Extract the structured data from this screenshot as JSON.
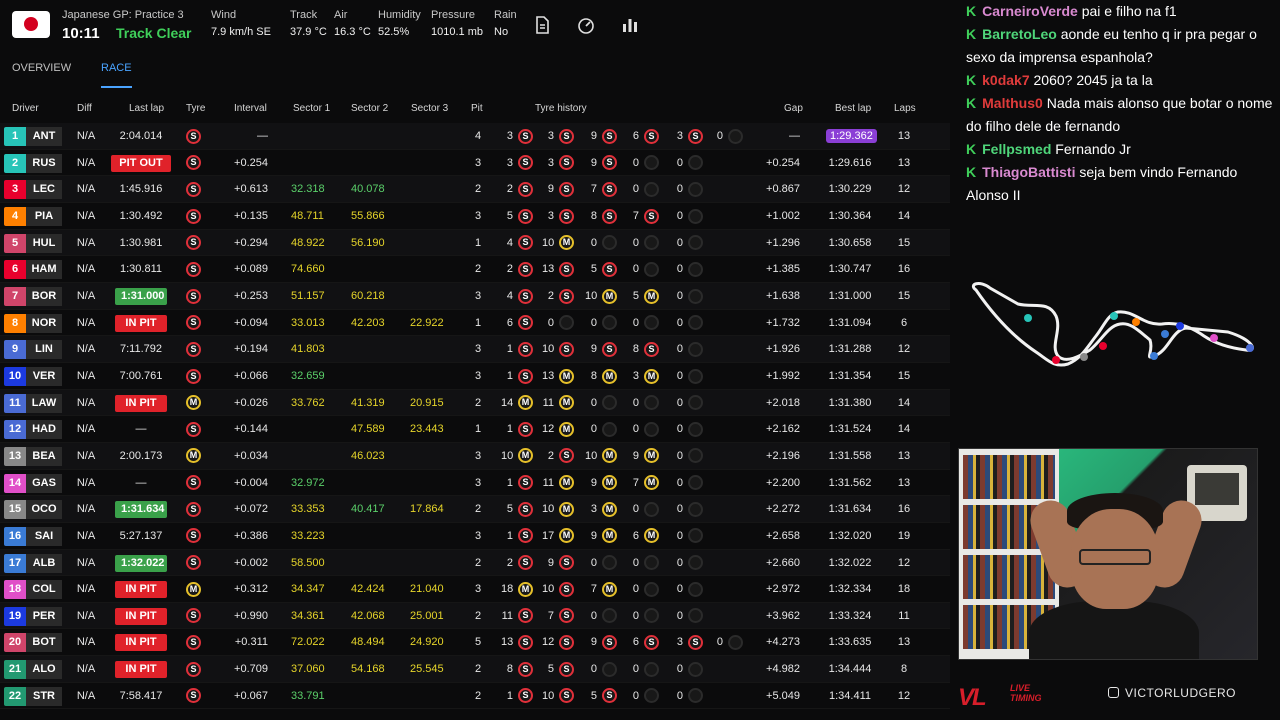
{
  "header": {
    "session": "Japanese GP: Practice 3",
    "clock": "10:11",
    "track_status": "Track Clear",
    "weather": [
      {
        "label": "Wind",
        "value": "7.9 km/h SE"
      },
      {
        "label": "Track",
        "value": "37.9 °C"
      },
      {
        "label": "Air",
        "value": "16.3 °C"
      },
      {
        "label": "Humidity",
        "value": "52.5%"
      },
      {
        "label": "Pressure",
        "value": "1010.1 mb"
      },
      {
        "label": "Rain",
        "value": "No"
      }
    ],
    "icons": [
      "document-icon",
      "gauge-icon",
      "bar-chart-icon"
    ]
  },
  "tabs": [
    "OVERVIEW",
    "RACE"
  ],
  "active_tab": "RACE",
  "columns": [
    "Driver",
    "Diff",
    "Last lap",
    "Tyre",
    "Interval",
    "Sector 1",
    "Sector 2",
    "Sector 3",
    "Pit",
    "Tyre history",
    "Gap",
    "Best lap",
    "Laps"
  ],
  "drivers": [
    {
      "pos": "1",
      "code": "ANT",
      "team_color": "#27c4b8",
      "diff": "N/A",
      "last": "2:04.014",
      "last_style": "",
      "tyre": "S",
      "interval": "—",
      "s1": "",
      "s1c": "",
      "s2": "",
      "s2c": "",
      "s3": "",
      "s3c": "",
      "pit": "4",
      "hist": [
        [
          "3",
          "S"
        ],
        [
          "3",
          "S"
        ],
        [
          "9",
          "S"
        ],
        [
          "6",
          "S"
        ],
        [
          "3",
          "S"
        ],
        [
          "0",
          "E"
        ]
      ],
      "gap": "—",
      "best": "1:29.362",
      "best_purple": true,
      "laps": "13"
    },
    {
      "pos": "2",
      "code": "RUS",
      "team_color": "#27c4b8",
      "diff": "N/A",
      "last": "PIT OUT",
      "last_style": "pitout",
      "tyre": "S",
      "interval": "+0.254",
      "s1": "",
      "s1c": "",
      "s2": "",
      "s2c": "",
      "s3": "",
      "s3c": "",
      "pit": "3",
      "hist": [
        [
          "3",
          "S"
        ],
        [
          "3",
          "S"
        ],
        [
          "9",
          "S"
        ],
        [
          "0",
          "E"
        ],
        [
          "0",
          "E"
        ]
      ],
      "gap": "+0.254",
      "best": "1:29.616",
      "best_purple": false,
      "laps": "13"
    },
    {
      "pos": "3",
      "code": "LEC",
      "team_color": "#e8002d",
      "diff": "N/A",
      "last": "1:45.916",
      "last_style": "",
      "tyre": "S",
      "interval": "+0.613",
      "s1": "32.318",
      "s1c": "green",
      "s2": "40.078",
      "s2c": "green",
      "s3": "",
      "s3c": "",
      "pit": "2",
      "hist": [
        [
          "2",
          "S"
        ],
        [
          "9",
          "S"
        ],
        [
          "7",
          "S"
        ],
        [
          "0",
          "E"
        ],
        [
          "0",
          "E"
        ]
      ],
      "gap": "+0.867",
      "best": "1:30.229",
      "best_purple": false,
      "laps": "12"
    },
    {
      "pos": "4",
      "code": "PIA",
      "team_color": "#ff8000",
      "diff": "N/A",
      "last": "1:30.492",
      "last_style": "",
      "tyre": "S",
      "interval": "+0.135",
      "s1": "48.711",
      "s1c": "yellow",
      "s2": "55.866",
      "s2c": "yellow",
      "s3": "",
      "s3c": "",
      "pit": "3",
      "hist": [
        [
          "5",
          "S"
        ],
        [
          "3",
          "S"
        ],
        [
          "8",
          "S"
        ],
        [
          "7",
          "S"
        ],
        [
          "0",
          "E"
        ]
      ],
      "gap": "+1.002",
      "best": "1:30.364",
      "best_purple": false,
      "laps": "14"
    },
    {
      "pos": "5",
      "code": "HUL",
      "team_color": "#d0456a",
      "diff": "N/A",
      "last": "1:30.981",
      "last_style": "",
      "tyre": "S",
      "interval": "+0.294",
      "s1": "48.922",
      "s1c": "yellow",
      "s2": "56.190",
      "s2c": "yellow",
      "s3": "",
      "s3c": "",
      "pit": "1",
      "hist": [
        [
          "4",
          "S"
        ],
        [
          "10",
          "M"
        ],
        [
          "0",
          "E"
        ],
        [
          "0",
          "E"
        ],
        [
          "0",
          "E"
        ]
      ],
      "gap": "+1.296",
      "best": "1:30.658",
      "best_purple": false,
      "laps": "15"
    },
    {
      "pos": "6",
      "code": "HAM",
      "team_color": "#e8002d",
      "diff": "N/A",
      "last": "1:30.811",
      "last_style": "",
      "tyre": "S",
      "interval": "+0.089",
      "s1": "74.660",
      "s1c": "yellow",
      "s2": "",
      "s2c": "",
      "s3": "",
      "s3c": "",
      "pit": "2",
      "hist": [
        [
          "2",
          "S"
        ],
        [
          "13",
          "S"
        ],
        [
          "5",
          "S"
        ],
        [
          "0",
          "E"
        ],
        [
          "0",
          "E"
        ]
      ],
      "gap": "+1.385",
      "best": "1:30.747",
      "best_purple": false,
      "laps": "16"
    },
    {
      "pos": "7",
      "code": "BOR",
      "team_color": "#d0456a",
      "diff": "N/A",
      "last": "1:31.000",
      "last_style": "green",
      "tyre": "S",
      "interval": "+0.253",
      "s1": "51.157",
      "s1c": "yellow",
      "s2": "60.218",
      "s2c": "yellow",
      "s3": "",
      "s3c": "",
      "pit": "3",
      "hist": [
        [
          "4",
          "S"
        ],
        [
          "2",
          "S"
        ],
        [
          "10",
          "M"
        ],
        [
          "5",
          "M"
        ],
        [
          "0",
          "E"
        ]
      ],
      "gap": "+1.638",
      "best": "1:31.000",
      "best_purple": false,
      "laps": "15"
    },
    {
      "pos": "8",
      "code": "NOR",
      "team_color": "#ff8000",
      "diff": "N/A",
      "last": "IN PIT",
      "last_style": "inpit",
      "tyre": "S",
      "interval": "+0.094",
      "s1": "33.013",
      "s1c": "yellow",
      "s2": "42.203",
      "s2c": "yellow",
      "s3": "22.922",
      "s3c": "yellow",
      "pit": "1",
      "hist": [
        [
          "6",
          "S"
        ],
        [
          "0",
          "E"
        ],
        [
          "0",
          "E"
        ],
        [
          "0",
          "E"
        ],
        [
          "0",
          "E"
        ]
      ],
      "gap": "+1.732",
      "best": "1:31.094",
      "best_purple": false,
      "laps": "6"
    },
    {
      "pos": "9",
      "code": "LIN",
      "team_color": "#4a6bd4",
      "diff": "N/A",
      "last": "7:11.792",
      "last_style": "",
      "tyre": "S",
      "interval": "+0.194",
      "s1": "41.803",
      "s1c": "yellow",
      "s2": "",
      "s2c": "",
      "s3": "",
      "s3c": "",
      "pit": "3",
      "hist": [
        [
          "1",
          "S"
        ],
        [
          "10",
          "S"
        ],
        [
          "9",
          "S"
        ],
        [
          "8",
          "S"
        ],
        [
          "0",
          "E"
        ]
      ],
      "gap": "+1.926",
      "best": "1:31.288",
      "best_purple": false,
      "laps": "12"
    },
    {
      "pos": "10",
      "code": "VER",
      "team_color": "#1c3ae0",
      "diff": "N/A",
      "last": "7:00.761",
      "last_style": "",
      "tyre": "S",
      "interval": "+0.066",
      "s1": "32.659",
      "s1c": "green",
      "s2": "",
      "s2c": "",
      "s3": "",
      "s3c": "",
      "pit": "3",
      "hist": [
        [
          "1",
          "S"
        ],
        [
          "13",
          "M"
        ],
        [
          "8",
          "M"
        ],
        [
          "3",
          "M"
        ],
        [
          "0",
          "E"
        ]
      ],
      "gap": "+1.992",
      "best": "1:31.354",
      "best_purple": false,
      "laps": "15"
    },
    {
      "pos": "11",
      "code": "LAW",
      "team_color": "#4a6bd4",
      "diff": "N/A",
      "last": "IN PIT",
      "last_style": "inpit",
      "tyre": "M",
      "interval": "+0.026",
      "s1": "33.762",
      "s1c": "yellow",
      "s2": "41.319",
      "s2c": "yellow",
      "s3": "20.915",
      "s3c": "yellow",
      "pit": "2",
      "hist": [
        [
          "14",
          "M"
        ],
        [
          "11",
          "M"
        ],
        [
          "0",
          "E"
        ],
        [
          "0",
          "E"
        ],
        [
          "0",
          "E"
        ]
      ],
      "gap": "+2.018",
      "best": "1:31.380",
      "best_purple": false,
      "laps": "14"
    },
    {
      "pos": "12",
      "code": "HAD",
      "team_color": "#4a6bd4",
      "diff": "N/A",
      "last": "—",
      "last_style": "",
      "tyre": "S",
      "interval": "+0.144",
      "s1": "",
      "s1c": "",
      "s2": "47.589",
      "s2c": "yellow",
      "s3": "23.443",
      "s3c": "yellow",
      "pit": "1",
      "hist": [
        [
          "1",
          "S"
        ],
        [
          "12",
          "M"
        ],
        [
          "0",
          "E"
        ],
        [
          "0",
          "E"
        ],
        [
          "0",
          "E"
        ]
      ],
      "gap": "+2.162",
      "best": "1:31.524",
      "best_purple": false,
      "laps": "14"
    },
    {
      "pos": "13",
      "code": "BEA",
      "team_color": "#888888",
      "diff": "N/A",
      "last": "2:00.173",
      "last_style": "",
      "tyre": "M",
      "interval": "+0.034",
      "s1": "",
      "s1c": "",
      "s2": "46.023",
      "s2c": "yellow",
      "s3": "",
      "s3c": "",
      "pit": "3",
      "hist": [
        [
          "10",
          "M"
        ],
        [
          "2",
          "S"
        ],
        [
          "10",
          "M"
        ],
        [
          "9",
          "M"
        ],
        [
          "0",
          "E"
        ]
      ],
      "gap": "+2.196",
      "best": "1:31.558",
      "best_purple": false,
      "laps": "13"
    },
    {
      "pos": "14",
      "code": "GAS",
      "team_color": "#e04fc8",
      "diff": "N/A",
      "last": "—",
      "last_style": "",
      "tyre": "S",
      "interval": "+0.004",
      "s1": "32.972",
      "s1c": "green",
      "s2": "",
      "s2c": "",
      "s3": "",
      "s3c": "",
      "pit": "3",
      "hist": [
        [
          "1",
          "S"
        ],
        [
          "11",
          "M"
        ],
        [
          "9",
          "M"
        ],
        [
          "7",
          "M"
        ],
        [
          "0",
          "E"
        ]
      ],
      "gap": "+2.200",
      "best": "1:31.562",
      "best_purple": false,
      "laps": "13"
    },
    {
      "pos": "15",
      "code": "OCO",
      "team_color": "#888888",
      "diff": "N/A",
      "last": "1:31.634",
      "last_style": "green",
      "tyre": "S",
      "interval": "+0.072",
      "s1": "33.353",
      "s1c": "yellow",
      "s2": "40.417",
      "s2c": "green",
      "s3": "17.864",
      "s3c": "yellow",
      "pit": "2",
      "hist": [
        [
          "5",
          "S"
        ],
        [
          "10",
          "M"
        ],
        [
          "3",
          "M"
        ],
        [
          "0",
          "E"
        ],
        [
          "0",
          "E"
        ]
      ],
      "gap": "+2.272",
      "best": "1:31.634",
      "best_purple": false,
      "laps": "16"
    },
    {
      "pos": "16",
      "code": "SAI",
      "team_color": "#3a7bd5",
      "diff": "N/A",
      "last": "5:27.137",
      "last_style": "",
      "tyre": "S",
      "interval": "+0.386",
      "s1": "33.223",
      "s1c": "yellow",
      "s2": "",
      "s2c": "",
      "s3": "",
      "s3c": "",
      "pit": "3",
      "hist": [
        [
          "1",
          "S"
        ],
        [
          "17",
          "M"
        ],
        [
          "9",
          "M"
        ],
        [
          "6",
          "M"
        ],
        [
          "0",
          "E"
        ]
      ],
      "gap": "+2.658",
      "best": "1:32.020",
      "best_purple": false,
      "laps": "19"
    },
    {
      "pos": "17",
      "code": "ALB",
      "team_color": "#3a7bd5",
      "diff": "N/A",
      "last": "1:32.022",
      "last_style": "green",
      "tyre": "S",
      "interval": "+0.002",
      "s1": "58.500",
      "s1c": "yellow",
      "s2": "",
      "s2c": "",
      "s3": "",
      "s3c": "",
      "pit": "2",
      "hist": [
        [
          "2",
          "S"
        ],
        [
          "9",
          "S"
        ],
        [
          "0",
          "E"
        ],
        [
          "0",
          "E"
        ],
        [
          "0",
          "E"
        ]
      ],
      "gap": "+2.660",
      "best": "1:32.022",
      "best_purple": false,
      "laps": "12"
    },
    {
      "pos": "18",
      "code": "COL",
      "team_color": "#e04fc8",
      "diff": "N/A",
      "last": "IN PIT",
      "last_style": "inpit",
      "tyre": "M",
      "interval": "+0.312",
      "s1": "34.347",
      "s1c": "yellow",
      "s2": "42.424",
      "s2c": "yellow",
      "s3": "21.040",
      "s3c": "yellow",
      "pit": "3",
      "hist": [
        [
          "18",
          "M"
        ],
        [
          "10",
          "S"
        ],
        [
          "7",
          "M"
        ],
        [
          "0",
          "E"
        ],
        [
          "0",
          "E"
        ]
      ],
      "gap": "+2.972",
      "best": "1:32.334",
      "best_purple": false,
      "laps": "18"
    },
    {
      "pos": "19",
      "code": "PER",
      "team_color": "#1c3ae0",
      "diff": "N/A",
      "last": "IN PIT",
      "last_style": "inpit",
      "tyre": "S",
      "interval": "+0.990",
      "s1": "34.361",
      "s1c": "yellow",
      "s2": "42.068",
      "s2c": "yellow",
      "s3": "25.001",
      "s3c": "yellow",
      "pit": "2",
      "hist": [
        [
          "11",
          "S"
        ],
        [
          "7",
          "S"
        ],
        [
          "0",
          "E"
        ],
        [
          "0",
          "E"
        ],
        [
          "0",
          "E"
        ]
      ],
      "gap": "+3.962",
      "best": "1:33.324",
      "best_purple": false,
      "laps": "11"
    },
    {
      "pos": "20",
      "code": "BOT",
      "team_color": "#d0456a",
      "diff": "N/A",
      "last": "IN PIT",
      "last_style": "inpit",
      "tyre": "S",
      "interval": "+0.311",
      "s1": "72.022",
      "s1c": "yellow",
      "s2": "48.494",
      "s2c": "yellow",
      "s3": "24.920",
      "s3c": "yellow",
      "pit": "5",
      "hist": [
        [
          "13",
          "S"
        ],
        [
          "12",
          "S"
        ],
        [
          "9",
          "S"
        ],
        [
          "6",
          "S"
        ],
        [
          "3",
          "S"
        ],
        [
          "0",
          "E"
        ]
      ],
      "gap": "+4.273",
      "best": "1:33.635",
      "best_purple": false,
      "laps": "13"
    },
    {
      "pos": "21",
      "code": "ALO",
      "team_color": "#229971",
      "diff": "N/A",
      "last": "IN PIT",
      "last_style": "inpit",
      "tyre": "S",
      "interval": "+0.709",
      "s1": "37.060",
      "s1c": "yellow",
      "s2": "54.168",
      "s2c": "yellow",
      "s3": "25.545",
      "s3c": "yellow",
      "pit": "2",
      "hist": [
        [
          "8",
          "S"
        ],
        [
          "5",
          "S"
        ],
        [
          "0",
          "E"
        ],
        [
          "0",
          "E"
        ],
        [
          "0",
          "E"
        ]
      ],
      "gap": "+4.982",
      "best": "1:34.444",
      "best_purple": false,
      "laps": "8"
    },
    {
      "pos": "22",
      "code": "STR",
      "team_color": "#229971",
      "diff": "N/A",
      "last": "7:58.417",
      "last_style": "",
      "tyre": "S",
      "interval": "+0.067",
      "s1": "33.791",
      "s1c": "green",
      "s2": "",
      "s2c": "",
      "s3": "",
      "s3c": "",
      "pit": "2",
      "hist": [
        [
          "1",
          "S"
        ],
        [
          "10",
          "S"
        ],
        [
          "5",
          "S"
        ],
        [
          "0",
          "E"
        ],
        [
          "0",
          "E"
        ]
      ],
      "gap": "+5.049",
      "best": "1:34.411",
      "best_purple": false,
      "laps": "12"
    }
  ],
  "chat": [
    {
      "user": "CarneiroVerde",
      "color": "#d98ad0",
      "text": "pai e filho na f1"
    },
    {
      "user": "BarretoLeo",
      "color": "#4fd67a",
      "text": "aonde eu tenho q ir pra pegar o sexo da imprensa espanhola?"
    },
    {
      "user": "k0dak7",
      "color": "#e03b3b",
      "text": "2060? 2045 ja ta la"
    },
    {
      "user": "Malthus0",
      "color": "#e03b3b",
      "text": "Nada mais alonso que botar o nome do filho dele de fernando"
    },
    {
      "user": "Fellpsmed",
      "color": "#4fd67a",
      "text": "Fernando Jr"
    },
    {
      "user": "ThiagoBattisti",
      "color": "#d98ad0",
      "text": "seja bem vindo Fernando Alonso II"
    }
  ],
  "brand": {
    "logo": "VL",
    "sub1": "LIVE",
    "sub2": "TIMING"
  },
  "handle": "VICTORLUDGERO",
  "colors": {
    "green": "#5bd06a",
    "yellow": "#e6d52a",
    "purple": "#8b3fd6",
    "inpit": "#e0222a",
    "soft": "#e0303a",
    "medium": "#e6c02a",
    "accent": "#4aa3ff"
  }
}
